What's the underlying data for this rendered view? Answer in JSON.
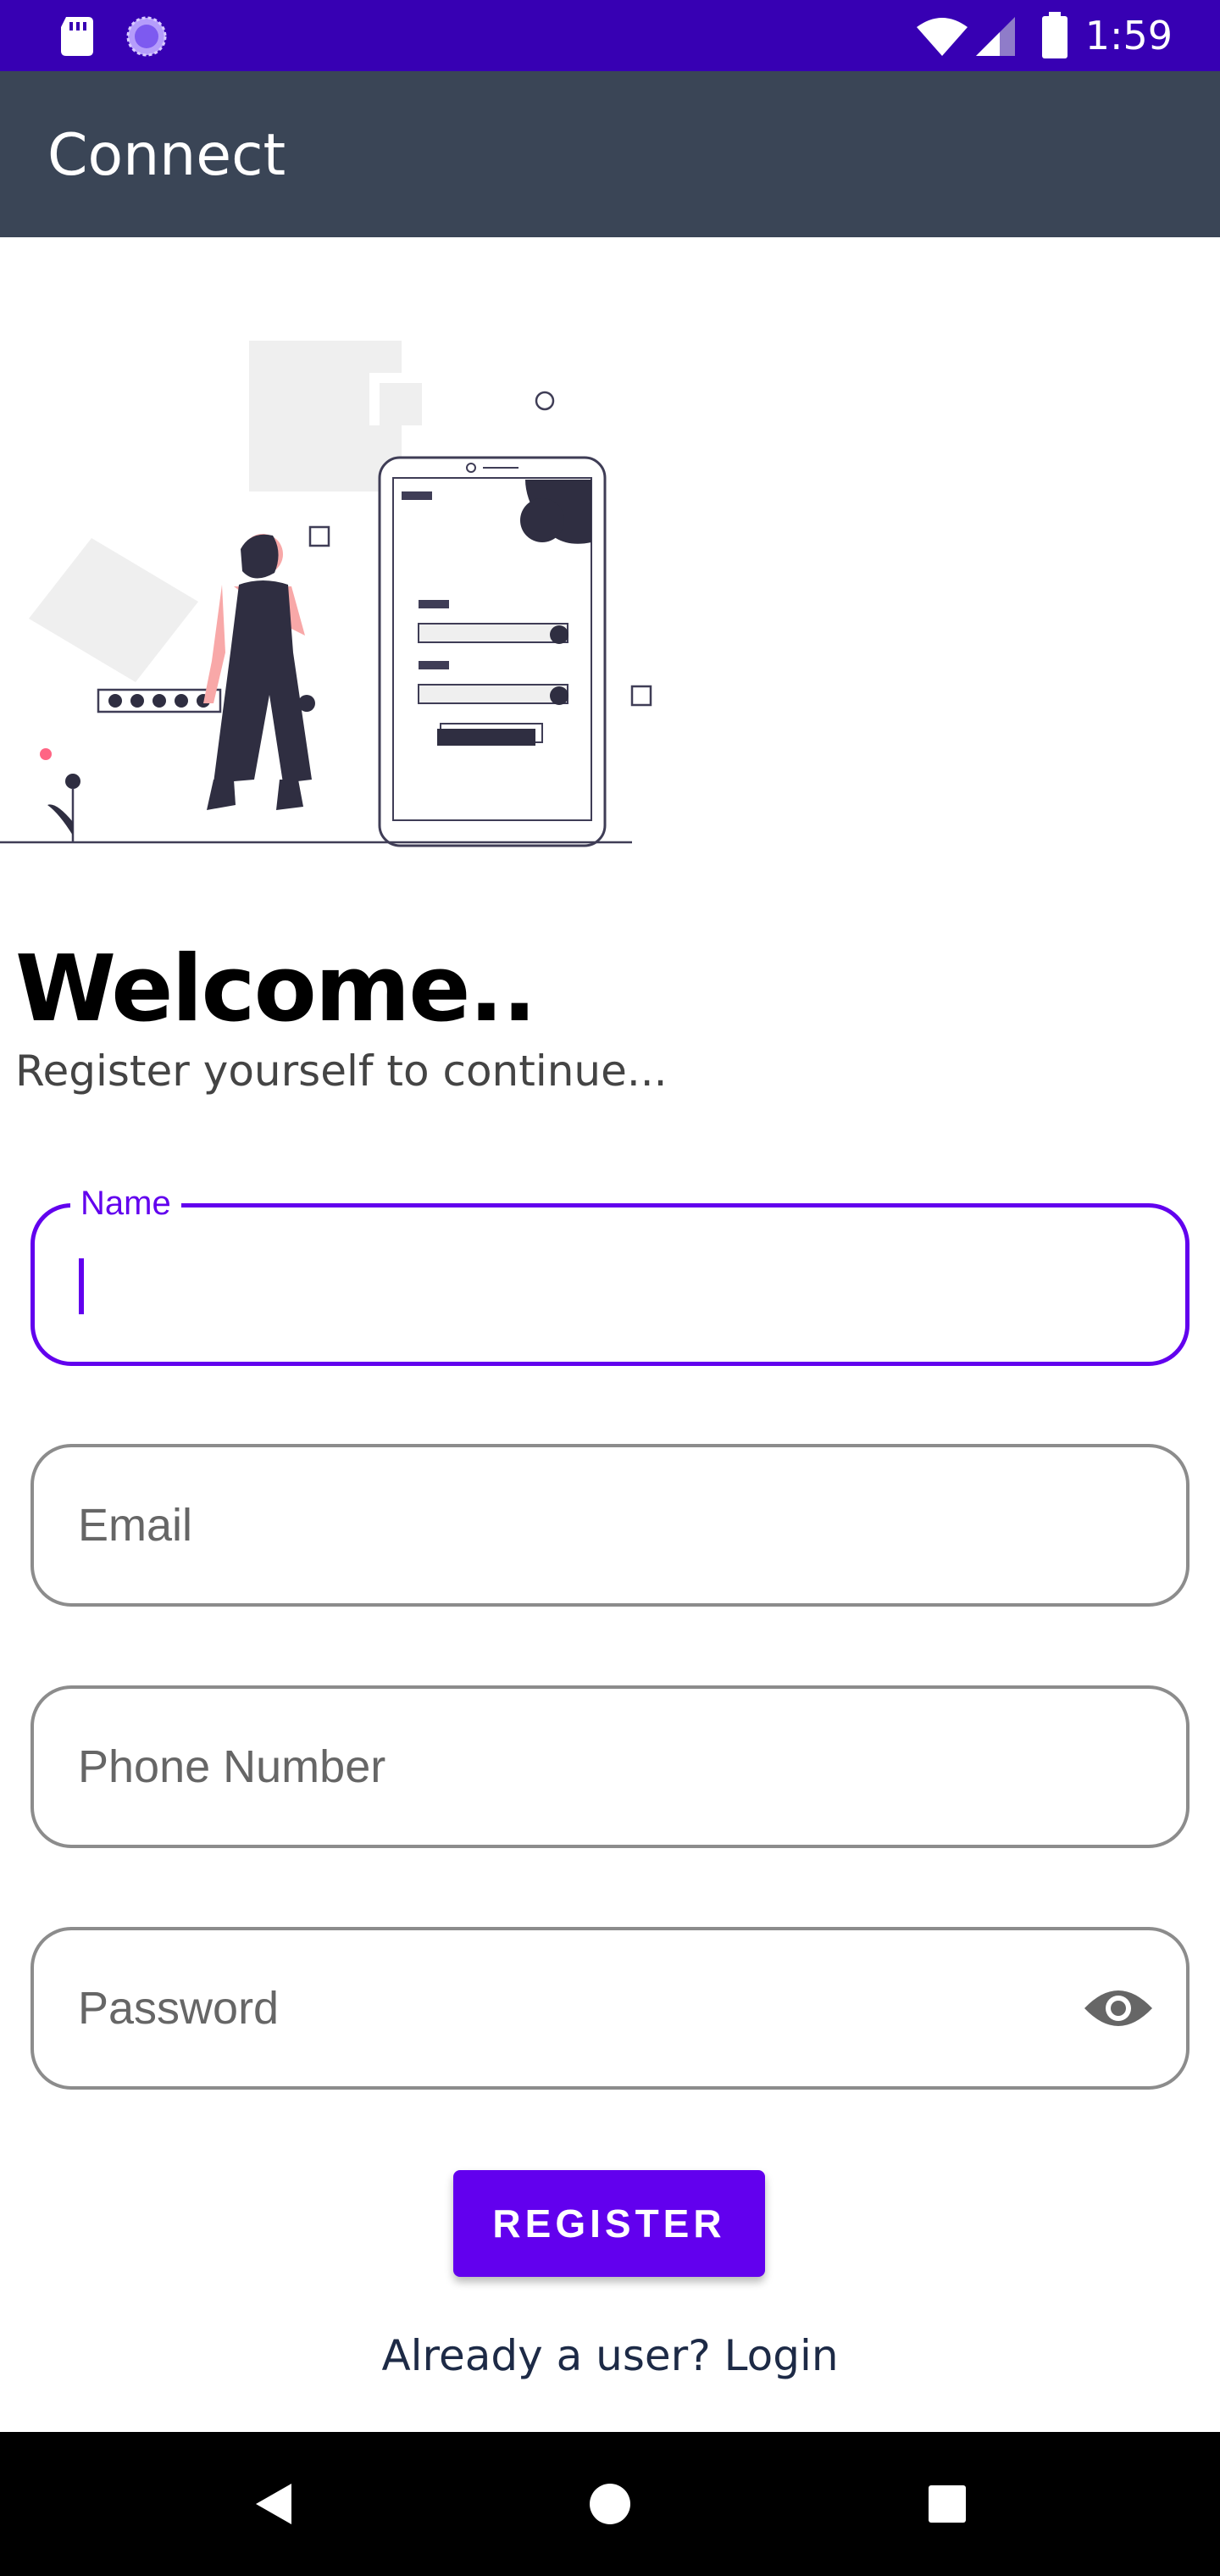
{
  "status_bar": {
    "time": "1:59",
    "left_icons": [
      "sd-card-icon",
      "loading-icon"
    ],
    "right_icons": [
      "wifi-icon",
      "signal-icon",
      "battery-icon"
    ],
    "background_color": "#3700b3"
  },
  "app_bar": {
    "title": "Connect",
    "background_color": "#3a4556"
  },
  "illustration": {
    "icon": "registration-illustration-icon"
  },
  "header": {
    "title": "Welcome..",
    "subtitle": "Register yourself to continue..."
  },
  "form": {
    "name": {
      "label": "Name",
      "value": "",
      "focused": true
    },
    "email": {
      "placeholder": "Email"
    },
    "phone": {
      "placeholder": "Phone Number"
    },
    "password": {
      "placeholder": "Password",
      "toggle_icon": "eye-icon"
    }
  },
  "actions": {
    "register_label": "REGISTER",
    "login_prompt": "Already a user? Login"
  },
  "colors": {
    "accent": "#6200ee",
    "outline": "#8c8c8c"
  },
  "nav_bar": {
    "icons": [
      "back-icon",
      "home-icon",
      "recents-icon"
    ]
  }
}
